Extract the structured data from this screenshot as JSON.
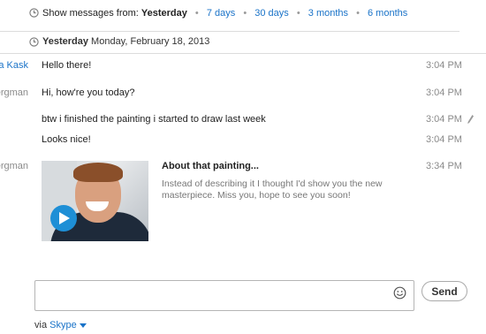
{
  "filter": {
    "label_prefix": "Show messages from: ",
    "selected": "Yesterday",
    "ranges": [
      "7 days",
      "30 days",
      "3 months",
      "6 months"
    ]
  },
  "day_header": {
    "day": "Yesterday",
    "date": "Monday, February 18, 2013"
  },
  "messages": [
    {
      "sender": "a Kask",
      "text": "Hello there!",
      "time": "3:04 PM"
    },
    {
      "sender": "ergman",
      "text": "Hi, how're you today?",
      "time": "3:04 PM"
    },
    {
      "sender": "",
      "text": "btw i finished the painting i started to draw last week",
      "time": "3:04 PM"
    },
    {
      "sender": "",
      "text": "Looks nice!",
      "time": "3:04 PM"
    }
  ],
  "shared_card": {
    "sender": "ergman",
    "time": "3:34 PM",
    "title": "About that painting...",
    "description": "Instead of describing it I thought I'd show you the new masterpiece. Miss you, hope to see you soon!"
  },
  "compose": {
    "value": "",
    "send_label": "Send",
    "via_prefix": "via ",
    "via_service": "Skype"
  },
  "colors": {
    "link": "#1a73c8",
    "play_button": "#1e8fd6",
    "muted": "#8a8a8a"
  }
}
